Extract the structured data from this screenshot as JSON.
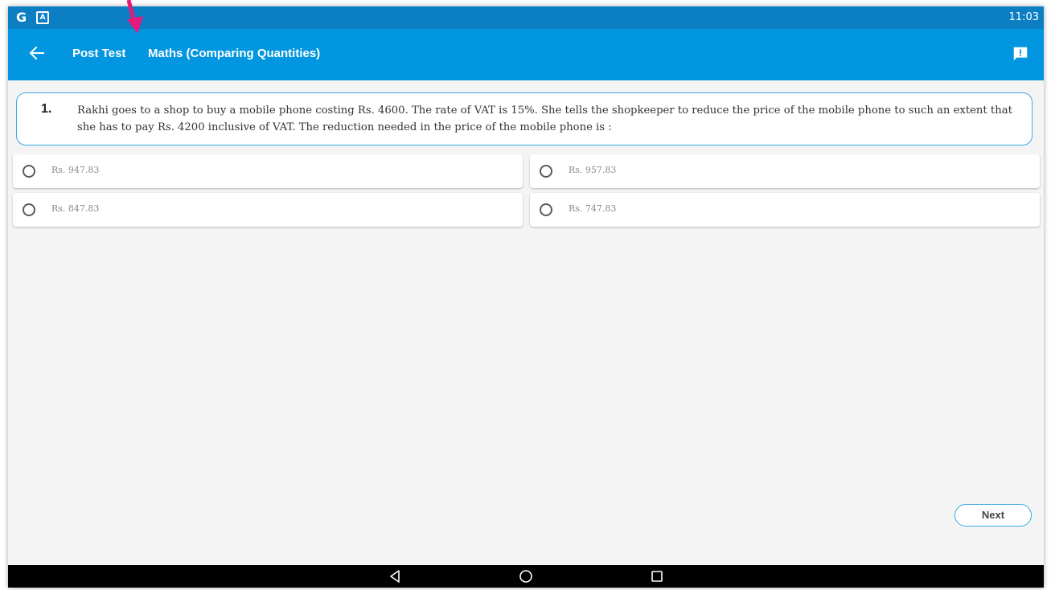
{
  "status_bar": {
    "left_icons": [
      "google-g-icon",
      "a-notification-icon"
    ],
    "g_glyph": "G",
    "a_glyph": "A",
    "time": "11:03"
  },
  "app_bar": {
    "back_icon": "arrow-left-icon",
    "title": "Post Test",
    "subtitle": "Maths (Comparing Quantities)",
    "feedback_icon": "feedback-icon"
  },
  "question": {
    "number": "1.",
    "text": "Rakhi goes to a shop to buy a mobile phone costing Rs. 4600. The rate of VAT is 15%. She tells the shopkeeper to reduce the price of the mobile phone to such an extent that she has to pay Rs. 4200 inclusive of VAT. The reduction needed in the price of the mobile phone is :"
  },
  "options": [
    {
      "label": "Rs. 947.83",
      "selected": false
    },
    {
      "label": "Rs. 957.83",
      "selected": false
    },
    {
      "label": "Rs. 847.83",
      "selected": false
    },
    {
      "label": "Rs. 747.83",
      "selected": false
    }
  ],
  "next_button": {
    "label": "Next"
  },
  "nav_bar": {
    "icons": [
      "nav-back-icon",
      "nav-home-icon",
      "nav-recents-icon"
    ]
  },
  "colors": {
    "status_bar": "#0c7fc4",
    "app_bar": "#0296e0",
    "accent_border": "#3aa8e6",
    "annotation_arrow": "#e6197a"
  }
}
